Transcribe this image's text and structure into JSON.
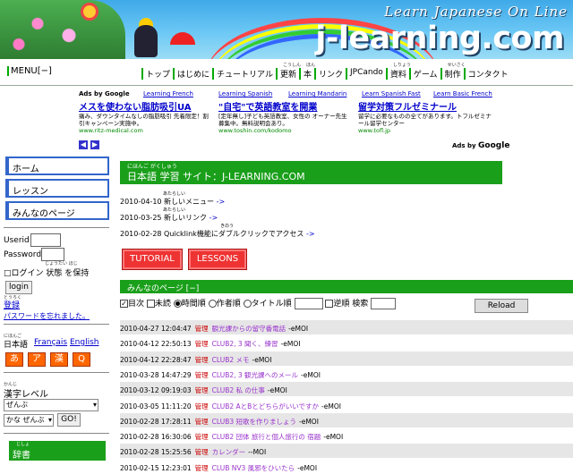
{
  "banner": {
    "tagline": "Learn Japanese On Line",
    "site_name": "j-learning.com"
  },
  "menu_toggle": "MENU[−]",
  "nav": [
    {
      "label": "トップ",
      "ruby": ""
    },
    {
      "label": "はじめに",
      "ruby": ""
    },
    {
      "label": "チュートリアル",
      "ruby": ""
    },
    {
      "label": "更新",
      "ruby": "こうしん"
    },
    {
      "label": "本",
      "ruby": "ほん"
    },
    {
      "label": "リンク",
      "ruby": ""
    },
    {
      "label": "JPCando",
      "ruby": ""
    },
    {
      "label": "資料",
      "ruby": "しりょう"
    },
    {
      "label": "ゲーム",
      "ruby": ""
    },
    {
      "label": "制作",
      "ruby": "せいさく"
    },
    {
      "label": "コンタクト",
      "ruby": ""
    }
  ],
  "ads": {
    "by_label": "Ads by Google",
    "links": [
      "Learning French",
      "Learning Spanish",
      "Learning Mandarin",
      "Learn Spanish Fast",
      "Learn Basic French"
    ],
    "items": [
      {
        "title": "メスを使わない脂肪吸引UA",
        "desc": "痛み、ダウンタイムなしの脂肪吸引 先着限定！割引キャンペーン実施中。",
        "url": "www.ritz-medical.com"
      },
      {
        "title": "\"自宅\"で英語教室を開業",
        "desc": "[定年無し]子ども英語教室、女性の オーナー先生募集中。無料説明会あり。",
        "url": "www.toshin.com/kodomo"
      },
      {
        "title": "留学対策フルゼミナール",
        "desc": "留学に必要なものの全てがあります。トフルゼミナール留学センター",
        "url": "www.tofl.jp"
      }
    ],
    "bottom_by": "Ads by",
    "google": "Google"
  },
  "sidebar": {
    "buttons": [
      "ホーム",
      "レッスン",
      "みんなのページ"
    ],
    "userid_label": "Userid",
    "password_label": "Password",
    "keep_login_label": "□ログイン 状態 を保持",
    "keep_ruby": "じょうたい         ほじ",
    "login_button": "login",
    "register_ruby": "とうろく",
    "register": "登録",
    "forgot": "パスワードを忘れました。",
    "lang_ruby": "にほんご",
    "lang_ja": "日本語",
    "lang_fr": "Français",
    "lang_en": "English",
    "script_buttons": [
      "あ",
      "ア",
      "漢",
      "Q"
    ],
    "kanji_ruby": "かんじ",
    "kanji_level": "漢字レベル",
    "kanji_select": "ぜんぶ",
    "kana_select": "かな ぜんぶ",
    "go_button": "GO!",
    "dict_ruby": "じしょ",
    "dict": "辞書"
  },
  "main": {
    "welcome_ruby": "にほんご  がくしゅう",
    "welcome_title": "日本語 学習 サイト：J-LEARNING.COM",
    "news": [
      {
        "date": "2010-04-10",
        "ruby": "あたらしい",
        "text": "新しいメニュー",
        "link": "->"
      },
      {
        "date": "2010-03-25",
        "ruby": "あたらしい",
        "text": "新しいリンク",
        "link": "->"
      },
      {
        "date": "2010-02-28",
        "ruby": "きのう",
        "text": "Quicklink機能にダブルクリックでアクセス",
        "link": "->"
      }
    ],
    "tutorial_button": "TUTORIAL",
    "lessons_button": "LESSONS",
    "pages_header": "みんなのページ [−]",
    "filter": {
      "toc": "目次",
      "unread": "未読",
      "time_order": "時間",
      "author_order": "作者",
      "title_order": "タイトル",
      "order": "順",
      "reverse": "逆順",
      "search": "検索",
      "reload": "Reload"
    },
    "rows": [
      {
        "date": "2010-04-27 12:04:47",
        "tag": "管理",
        "title": "観光課からの留守番電話",
        "author": "-eMOI"
      },
      {
        "date": "2010-04-12 22:50:13",
        "tag": "管理",
        "title": "CLUB2, 3 聞く、練習",
        "author": "-eMOI"
      },
      {
        "date": "2010-04-12 22:28:47",
        "tag": "管理",
        "title": "CLUB2 メモ",
        "author": "-eMOI"
      },
      {
        "date": "2010-03-28 14:47:29",
        "tag": "管理",
        "title": "CLUB2, 3 観光課へのメール",
        "author": "-eMOI"
      },
      {
        "date": "2010-03-12 09:19:03",
        "tag": "管理",
        "title": "CLUB2 私 の仕事",
        "author": "-eMOI"
      },
      {
        "date": "2010-03-05 11:11:20",
        "tag": "管理",
        "title": "CLUB2 AとBとどちらがいいですか",
        "author": "-eMOI"
      },
      {
        "date": "2010-02-28 17:28:11",
        "tag": "管理",
        "title": "CLUB3 短歌を作りましょう",
        "author": "-eMOI"
      },
      {
        "date": "2010-02-28 16:30:06",
        "tag": "管理",
        "title": "CLUB2 団体 旅行と個人旅行の 宿題",
        "author": "-eMOI"
      },
      {
        "date": "2010-02-28 15:25:56",
        "tag": "管理",
        "title": "カレンダー",
        "author": "--MOI"
      },
      {
        "date": "2010-02-15 12:23:01",
        "tag": "管理",
        "title": "CLUB NV3 風邪をひいたら",
        "author": "-eMOI"
      }
    ]
  }
}
